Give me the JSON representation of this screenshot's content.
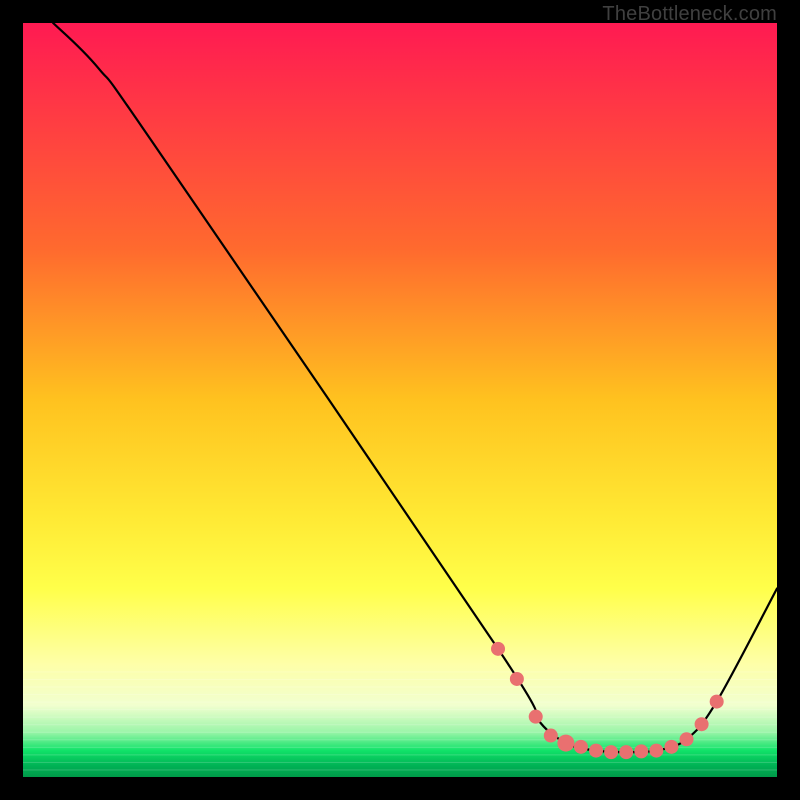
{
  "watermark": "TheBottleneck.com",
  "colors": {
    "bg": "#000000",
    "gradient_top": "#ff1a52",
    "gradient_mid_upper": "#ff7a33",
    "gradient_mid": "#ffd11a",
    "gradient_mid_lower": "#ffff3e",
    "gradient_pale": "#f6ffb0",
    "gradient_green": "#10e268",
    "gradient_dark_green": "#009a49",
    "curve": "#000000",
    "marker": "#e97070"
  },
  "chart_data": {
    "type": "line",
    "title": "",
    "xlabel": "",
    "ylabel": "",
    "xlim": [
      0,
      100
    ],
    "ylim": [
      0,
      100
    ],
    "curve": [
      {
        "x": 4,
        "y": 100
      },
      {
        "x": 10,
        "y": 94
      },
      {
        "x": 18,
        "y": 83
      },
      {
        "x": 63,
        "y": 17
      },
      {
        "x": 68,
        "y": 8
      },
      {
        "x": 72,
        "y": 4.5
      },
      {
        "x": 76,
        "y": 3.5
      },
      {
        "x": 80,
        "y": 3.3
      },
      {
        "x": 84,
        "y": 3.5
      },
      {
        "x": 88,
        "y": 5
      },
      {
        "x": 92,
        "y": 10
      },
      {
        "x": 100,
        "y": 25
      }
    ],
    "markers": [
      {
        "x": 63,
        "y": 17,
        "sel": false
      },
      {
        "x": 65.5,
        "y": 13,
        "sel": false
      },
      {
        "x": 68,
        "y": 8,
        "sel": false
      },
      {
        "x": 70,
        "y": 5.5,
        "sel": false
      },
      {
        "x": 72,
        "y": 4.5,
        "sel": true
      },
      {
        "x": 74,
        "y": 4,
        "sel": false
      },
      {
        "x": 76,
        "y": 3.5,
        "sel": false
      },
      {
        "x": 78,
        "y": 3.3,
        "sel": false
      },
      {
        "x": 80,
        "y": 3.3,
        "sel": false
      },
      {
        "x": 82,
        "y": 3.4,
        "sel": false
      },
      {
        "x": 84,
        "y": 3.5,
        "sel": false
      },
      {
        "x": 86,
        "y": 4,
        "sel": false
      },
      {
        "x": 88,
        "y": 5,
        "sel": false
      },
      {
        "x": 90,
        "y": 7,
        "sel": false
      },
      {
        "x": 92,
        "y": 10,
        "sel": false
      }
    ]
  }
}
